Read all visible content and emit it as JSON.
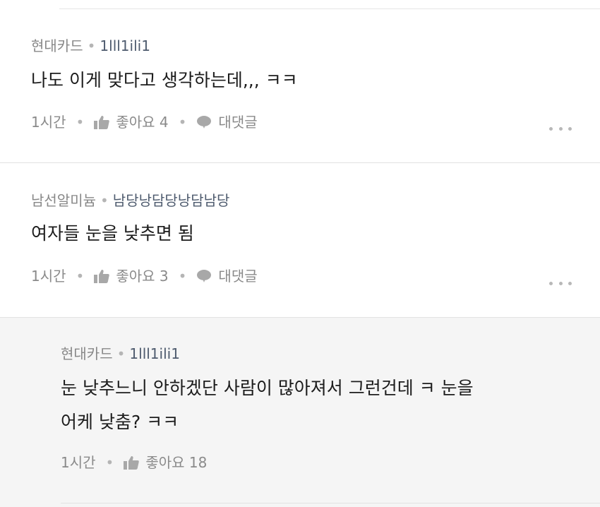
{
  "comments": [
    {
      "author": "현대카드",
      "user_id": "1lll1ili1",
      "text_lines": [
        "나도 이게 맞다고 생각하는데,,, ㅋㅋ"
      ],
      "time": "1시간",
      "like_label": "좋아요",
      "like_count": "4",
      "reply_label": "대댓글"
    },
    {
      "author": "남선알미늄",
      "user_id": "남당낭담당낭담남당",
      "text_lines": [
        "여자들 눈을 낮추면 됨"
      ],
      "time": "1시간",
      "like_label": "좋아요",
      "like_count": "3",
      "reply_label": "대댓글"
    }
  ],
  "reply": {
    "author": "현대카드",
    "user_id": "1lll1ili1",
    "text_lines": [
      "눈 낮추느니 안하겠단 사람이 많아져서 그런건데 ㅋ 눈을",
      "어케 낮춤? ㅋㅋ"
    ],
    "time": "1시간",
    "like_label": "좋아요",
    "like_count": "18"
  },
  "icons": {
    "like": "thumbs-up-icon",
    "reply": "speech-bubble-icon",
    "more": "more-dots-icon"
  },
  "colors": {
    "meta": "#888888",
    "user_id": "#4e5b6e",
    "reply_bg": "#f5f5f5",
    "separator": "#e2e2e2"
  }
}
